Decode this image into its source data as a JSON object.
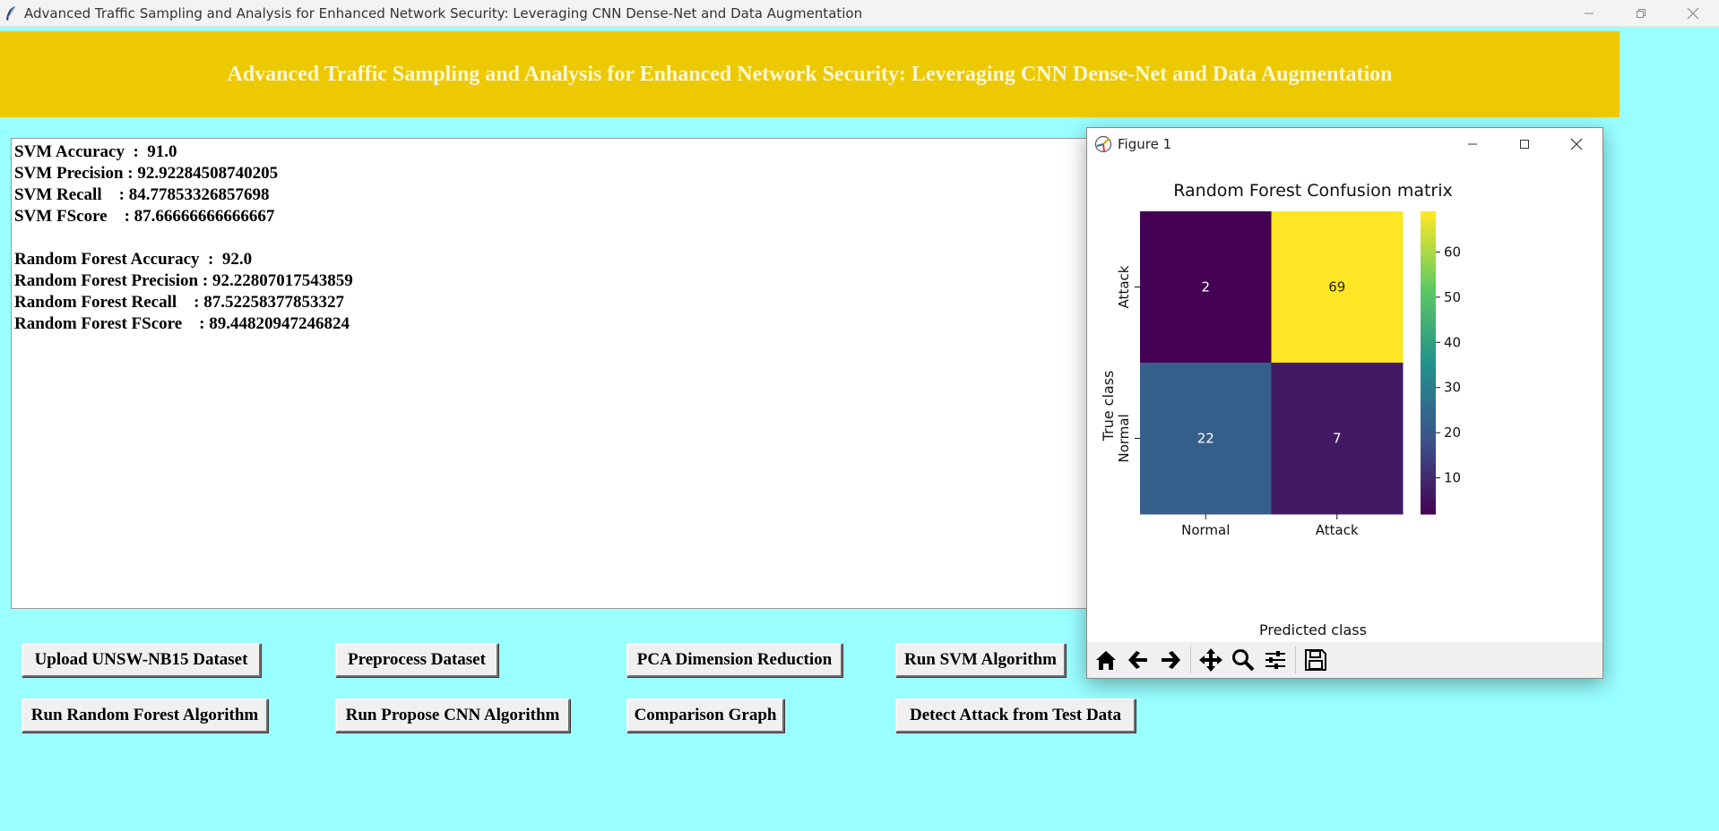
{
  "window": {
    "title": "Advanced Traffic Sampling and Analysis for Enhanced Network Security: Leveraging CNN Dense-Net and Data Augmentation"
  },
  "header": {
    "text": "Advanced Traffic Sampling and Analysis for Enhanced Network Security: Leveraging CNN Dense-Net and Data Augmentation"
  },
  "output": {
    "lines": [
      "SVM Accuracy  :  91.0",
      "SVM Precision : 92.92284508740205",
      "SVM Recall    : 84.77853326857698",
      "SVM FScore    : 87.66666666666667",
      "",
      "Random Forest Accuracy  :  92.0",
      "Random Forest Precision : 92.22807017543859",
      "Random Forest Recall    : 87.52258377853327",
      "Random Forest FScore    : 89.44820947246824"
    ]
  },
  "buttons": {
    "upload": "Upload UNSW-NB15 Dataset",
    "preprocess": "Preprocess Dataset",
    "pca": "PCA Dimension Reduction",
    "svm": "Run SVM Algorithm",
    "rf": "Run Random Forest Algorithm",
    "cnn": "Run Propose CNN Algorithm",
    "comparison": "Comparison Graph",
    "detect": "Detect Attack from Test Data"
  },
  "figure": {
    "window_title": "Figure 1",
    "toolbar_icons": [
      "home-icon",
      "back-arrow-icon",
      "forward-arrow-icon",
      "pan-icon",
      "zoom-icon",
      "configure-subplots-icon",
      "save-icon"
    ]
  },
  "chart_data": {
    "type": "heatmap",
    "title": "Random Forest Confusion matrix",
    "xlabel": "Predicted class",
    "ylabel": "True class",
    "x_categories": [
      "Normal",
      "Attack"
    ],
    "y_categories": [
      "Attack",
      "Normal"
    ],
    "values": [
      [
        2,
        69
      ],
      [
        22,
        7
      ]
    ],
    "colormap": "viridis",
    "colorbar": {
      "min": 2,
      "max": 69,
      "ticks": [
        10,
        20,
        30,
        40,
        50,
        60
      ]
    }
  },
  "colors": {
    "background": "#99ffff",
    "header_bg": "#ecc903",
    "header_text": "#fdf7d6"
  }
}
